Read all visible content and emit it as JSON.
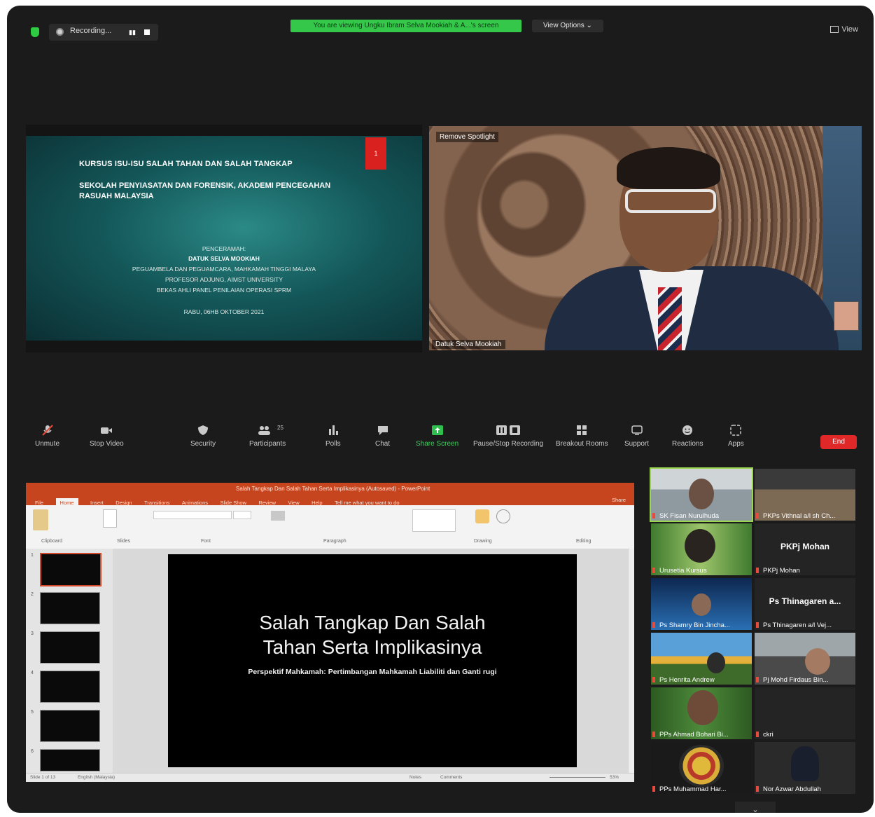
{
  "topbar": {
    "recording_label": "Recording...",
    "pause_icon": "▮▮",
    "viewing_banner": "You are viewing Ungku Ibram Selva Mookiah & A...'s screen",
    "view_options": "View Options ⌄",
    "view_label": "View"
  },
  "shared_slide": {
    "page_num": "1",
    "title": "KURSUS ISU-ISU SALAH TAHAN DAN SALAH TANGKAP",
    "subtitle": "SEKOLAH PENYIASATAN DAN FORENSIK, AKADEMI PENCEGAHAN RASUAH MALAYSIA",
    "lines": [
      "PENCERAMAH:",
      "DATUK SELVA MOOKIAH",
      "PEGUAMBELA DAN PEGUAMCARA, MAHKAMAH TINGGI MALAYA",
      "PROFESOR ADJUNG, AIMST UNIVERSITY",
      "BEKAS AHLI PANEL PENILAIAN OPERASI SPRM",
      "RABU, 06HB OKTOBER 2021"
    ]
  },
  "speaker": {
    "spotlight": "Remove Spotlight",
    "name": "Datuk Selva Mookiah"
  },
  "toolbar": {
    "unmute": "Unmute",
    "stop_video": "Stop Video",
    "security": "Security",
    "participants": "Participants",
    "participants_count": "25",
    "polls": "Polls",
    "chat": "Chat",
    "share_screen": "Share Screen",
    "pause_stop_recording": "Pause/Stop Recording",
    "breakout_rooms": "Breakout Rooms",
    "support": "Support",
    "reactions": "Reactions",
    "apps": "Apps",
    "end": "End"
  },
  "powerpoint": {
    "title": "Salah Tangkap Dan Salah Tahan Serta Implikasinya (Autosaved) - PowerPoint",
    "tabs": [
      "File",
      "Home",
      "Insert",
      "Design",
      "Transitions",
      "Animations",
      "Slide Show",
      "Review",
      "View",
      "Help",
      "Tell me what you want to do"
    ],
    "share": "Share",
    "ribbon_groups": [
      "Clipboard",
      "Slides",
      "Font",
      "Paragraph",
      "Drawing",
      "Editing"
    ],
    "slide_numbers": [
      "1",
      "2",
      "3",
      "4",
      "5",
      "6"
    ],
    "slide_title_line1": "Salah Tangkap Dan Salah",
    "slide_title_line2": "Tahan Serta Implikasinya",
    "slide_subtitle": "Perspektif Mahkamah: Pertimbangan Mahkamah Liabiliti dan Ganti rugi",
    "status_left": "Slide 1 of 13",
    "status_lang": "English (Malaysia)",
    "status_notes": "Notes",
    "status_comments": "Comments",
    "zoom": "53%"
  },
  "gallery": {
    "tiles": [
      {
        "name": "SK Fisan Nurulhuda",
        "center": ""
      },
      {
        "name": "PKPs Vithnal a/l sh Ch...",
        "center": ""
      },
      {
        "name": "Urusetia Kursus",
        "center": ""
      },
      {
        "name": "PKPj Mohan",
        "center": "PKPj Mohan"
      },
      {
        "name": "Ps Shamry Bin Jincha...",
        "center": ""
      },
      {
        "name": "Ps Thinagaren a/l Vej...",
        "center": "Ps Thinagaren a..."
      },
      {
        "name": "Ps Henrita Andrew",
        "center": ""
      },
      {
        "name": "Pj Mohd Firdaus Bin...",
        "center": ""
      },
      {
        "name": "PPs Ahmad Bohari Bi...",
        "center": ""
      },
      {
        "name": "ckri",
        "center": ""
      },
      {
        "name": "PPs Muhammad Har...",
        "center": ""
      },
      {
        "name": "Nor Azwar Abdullah",
        "center": ""
      }
    ],
    "more": "⌄"
  }
}
